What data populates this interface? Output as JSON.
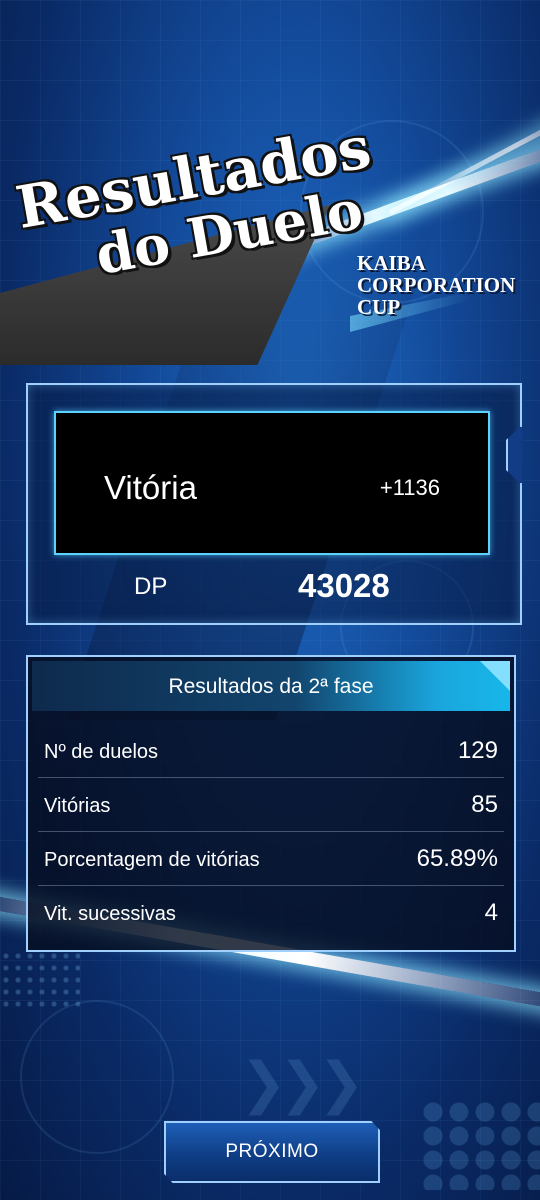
{
  "title": {
    "line1": "Resultados",
    "line2": "do Duelo"
  },
  "event_name": {
    "line1": "KAIBA",
    "line2": "CORPORATION",
    "line3": "CUP"
  },
  "result": {
    "label": "Vitória",
    "delta": "+1136"
  },
  "dp": {
    "label": "DP",
    "value": "43028"
  },
  "stats": {
    "header": "Resultados da 2ª fase",
    "rows": [
      {
        "label": "Nº de duelos",
        "value": "129"
      },
      {
        "label": "Vitórias",
        "value": "85"
      },
      {
        "label": "Porcentagem de vitórias",
        "value": "65.89%"
      },
      {
        "label": "Vit. sucessivas",
        "value": "4"
      }
    ]
  },
  "next_button": {
    "label": "PRÓXIMO"
  },
  "colors": {
    "accent": "#5bd3ff",
    "panel_border": "#9fd0ff",
    "background": "#134a9a"
  }
}
